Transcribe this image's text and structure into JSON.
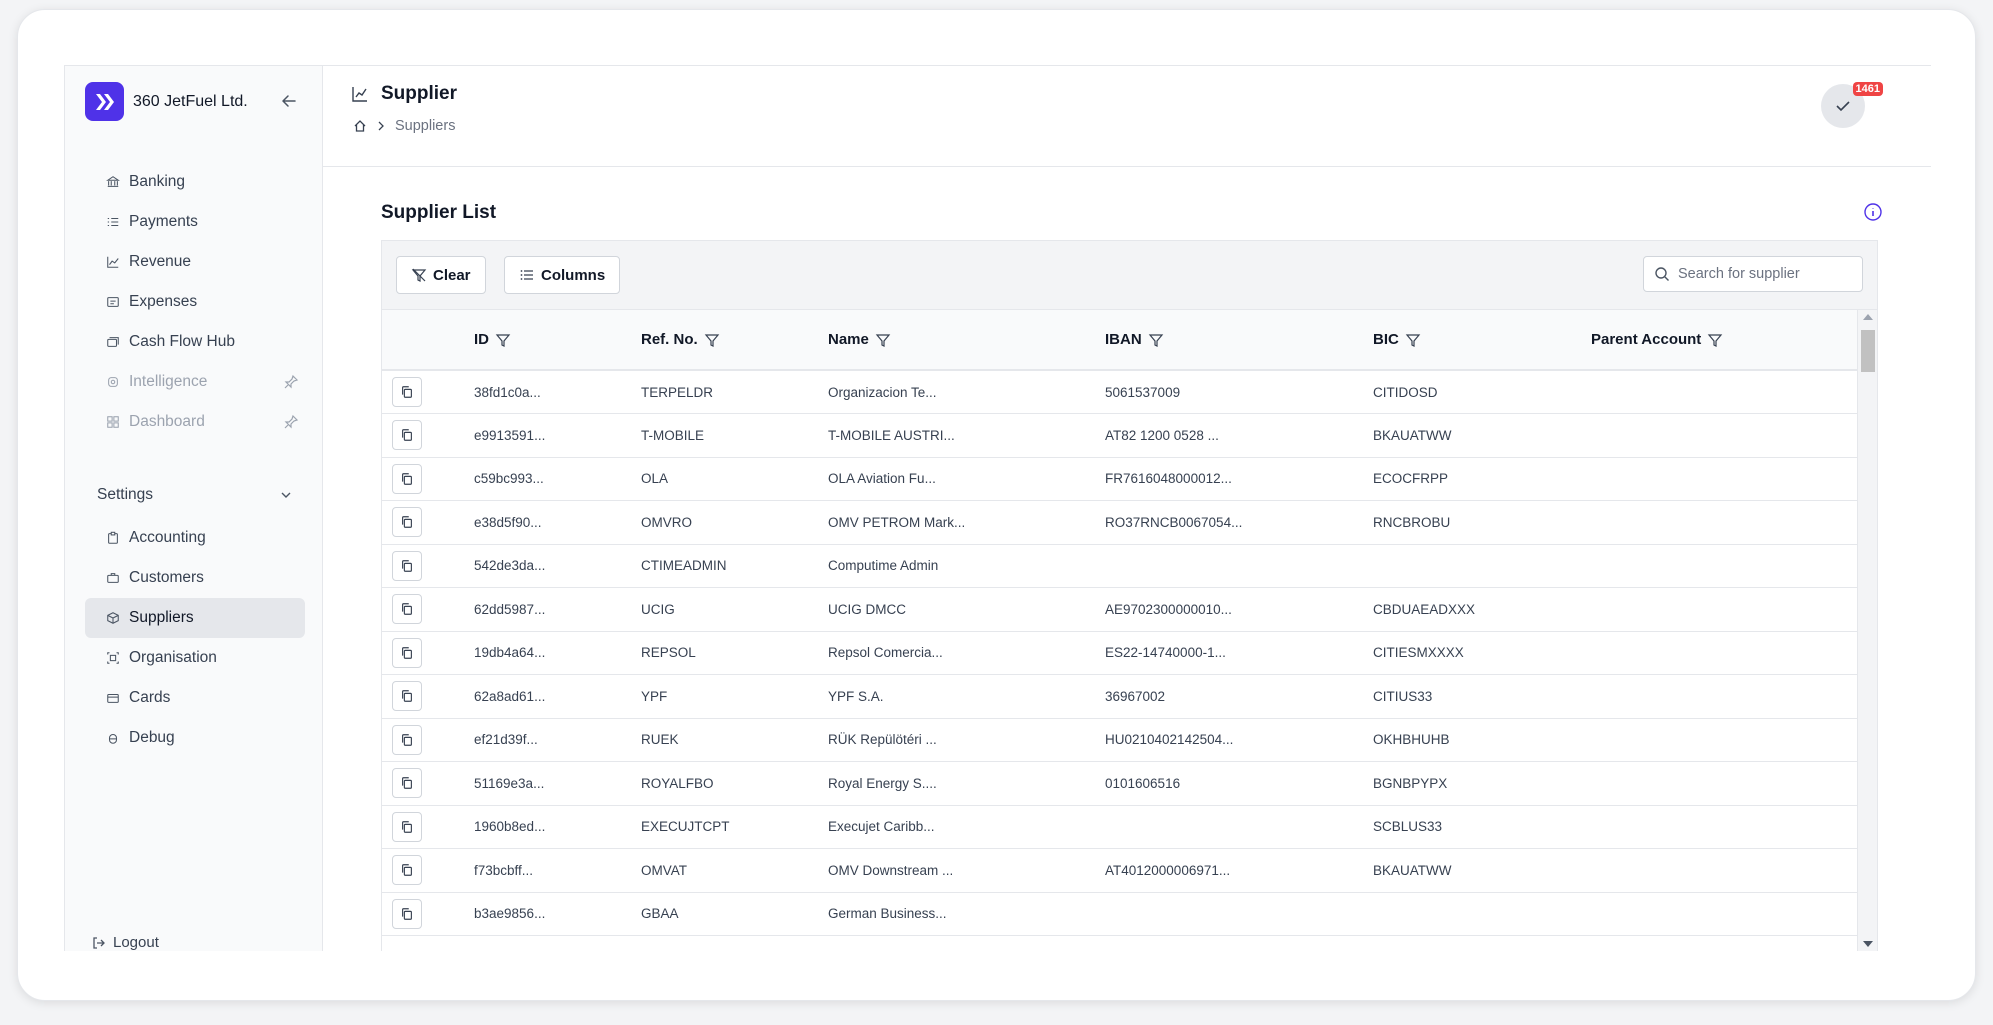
{
  "brand": {
    "name": "360 JetFuel Ltd."
  },
  "sidebar": {
    "items": [
      {
        "label": "Banking",
        "icon": "bank-icon",
        "disabled": false
      },
      {
        "label": "Payments",
        "icon": "list-icon",
        "disabled": false
      },
      {
        "label": "Revenue",
        "icon": "chart-line-icon",
        "disabled": false
      },
      {
        "label": "Expenses",
        "icon": "receipt-icon",
        "disabled": false
      },
      {
        "label": "Cash Flow Hub",
        "icon": "cash-icon",
        "disabled": false
      },
      {
        "label": "Intelligence",
        "icon": "brain-icon",
        "disabled": true
      },
      {
        "label": "Dashboard",
        "icon": "dashboard-icon",
        "disabled": true
      }
    ],
    "settings_label": "Settings",
    "settings_items": [
      {
        "label": "Accounting",
        "icon": "clipboard-icon",
        "active": false
      },
      {
        "label": "Customers",
        "icon": "briefcase-icon",
        "active": false
      },
      {
        "label": "Suppliers",
        "icon": "box-icon",
        "active": true
      },
      {
        "label": "Organisation",
        "icon": "org-icon",
        "active": false
      },
      {
        "label": "Cards",
        "icon": "card-icon",
        "active": false
      },
      {
        "label": "Debug",
        "icon": "bug-icon",
        "active": false
      }
    ],
    "logout_label": "Logout"
  },
  "header": {
    "title": "Supplier",
    "breadcrumb": "Suppliers",
    "notification_count": "1461"
  },
  "main": {
    "list_title": "Supplier List",
    "clear_label": "Clear",
    "columns_label": "Columns",
    "search_placeholder": "Search for supplier"
  },
  "table": {
    "columns": [
      "ID",
      "Ref. No.",
      "Name",
      "IBAN",
      "BIC",
      "Parent Account"
    ],
    "rows": [
      [
        "38fd1c0a...",
        "TERPELDR",
        "Organizacion Te...",
        "5061537009",
        "CITIDOSD",
        ""
      ],
      [
        "e9913591...",
        "T-MOBILE",
        "T-MOBILE AUSTRI...",
        "AT82 1200 0528 ...",
        "BKAUATWW",
        ""
      ],
      [
        "c59bc993...",
        "OLA",
        "OLA Aviation Fu...",
        "FR7616048000012...",
        "ECOCFRPP",
        ""
      ],
      [
        "e38d5f90...",
        "OMVRO",
        "OMV PETROM Mark...",
        "RO37RNCB0067054...",
        "RNCBROBU",
        ""
      ],
      [
        "542de3da...",
        "CTIMEADMIN",
        "Computime Admin",
        "",
        "",
        ""
      ],
      [
        "62dd5987...",
        "UCIG",
        "UCIG DMCC",
        "AE9702300000010...",
        "CBDUAEADXXX",
        ""
      ],
      [
        "19db4a64...",
        "REPSOL",
        "Repsol Comercia...",
        "ES22-14740000-1...",
        "CITIESMXXXX",
        ""
      ],
      [
        "62a8ad61...",
        "YPF",
        "YPF S.A.",
        "36967002",
        "CITIUS33",
        ""
      ],
      [
        "ef21d39f...",
        "RUEK",
        "RÜK Repülötéri ...",
        "HU0210402142504...",
        "OKHBHUHB",
        ""
      ],
      [
        "51169e3a...",
        "ROYALFBO",
        "Royal Energy S....",
        "0101606516",
        "BGNBPYPX",
        ""
      ],
      [
        "1960b8ed...",
        "EXECUJTCPT",
        "Execujet Caribb...",
        "",
        "SCBLUS33",
        ""
      ],
      [
        "f73bcbff...",
        "OMVAT",
        "OMV Downstream ...",
        "AT4012000006971...",
        "BKAUATWW",
        ""
      ],
      [
        "b3ae9856...",
        "GBAA",
        "German Business...",
        "",
        "",
        ""
      ]
    ]
  },
  "colors": {
    "accent": "#4f32e8",
    "badge": "#ef4444"
  }
}
